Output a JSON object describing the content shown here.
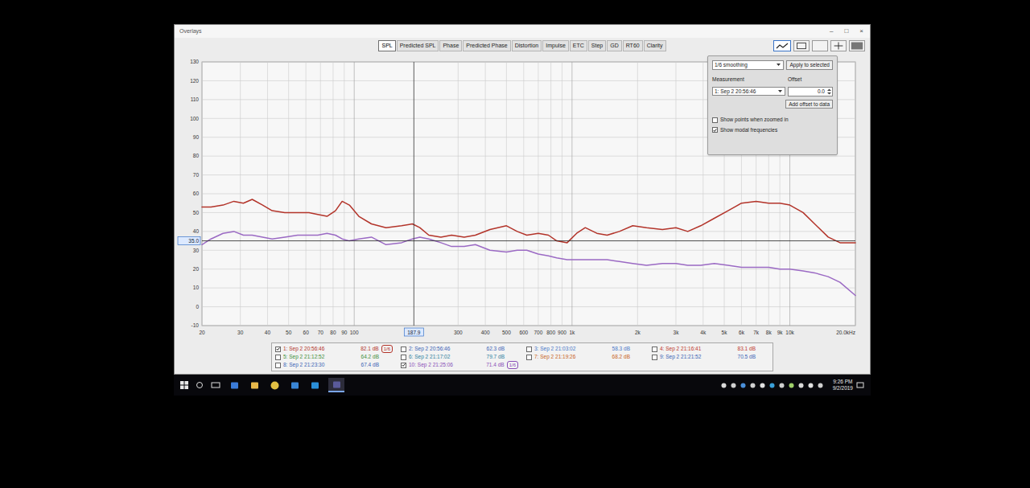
{
  "window": {
    "title": "Overlays",
    "controls": [
      "–",
      "□",
      "×"
    ]
  },
  "tabs": [
    {
      "label": "SPL",
      "selected": true
    },
    {
      "label": "Predicted SPL",
      "selected": false
    },
    {
      "label": "Phase",
      "selected": false
    },
    {
      "label": "Predicted Phase",
      "selected": false
    },
    {
      "label": "Distortion",
      "selected": false
    },
    {
      "label": "Impulse",
      "selected": false
    },
    {
      "label": "ETC",
      "selected": false
    },
    {
      "label": "Step",
      "selected": false
    },
    {
      "label": "GD",
      "selected": false
    },
    {
      "label": "RT60",
      "selected": false
    },
    {
      "label": "Clarity",
      "selected": false
    }
  ],
  "overlay_panel": {
    "smoothing": "1/6 smoothing",
    "apply_button": "Apply to selected",
    "measurement_label": "Measurement",
    "measurement": "1: Sep 2 20:56:46",
    "offset_label": "Offset",
    "offset": "0.0",
    "add_offset_button": "Add offset to data",
    "options": [
      {
        "label": "Show points when zoomed in",
        "checked": false
      },
      {
        "label": "Show modal frequencies",
        "checked": true
      }
    ]
  },
  "chart": {
    "y_ticks": [
      {
        "label": "130",
        "value": 130
      },
      {
        "label": "120",
        "value": 120
      },
      {
        "label": "110",
        "value": 110
      },
      {
        "label": "100",
        "value": 100
      },
      {
        "label": "90",
        "value": 90
      },
      {
        "label": "80",
        "value": 80
      },
      {
        "label": "70",
        "value": 70
      },
      {
        "label": "60",
        "value": 60
      },
      {
        "label": "50",
        "value": 50
      },
      {
        "label": "40",
        "value": 40
      },
      {
        "label": "30",
        "value": 30
      },
      {
        "label": "20",
        "value": 20
      },
      {
        "label": "10",
        "value": 10
      },
      {
        "label": "0",
        "value": 0
      },
      {
        "label": "-10",
        "value": -10
      }
    ],
    "x_ticks": [
      {
        "label": "20",
        "value": 20
      },
      {
        "label": "30",
        "value": 30
      },
      {
        "label": "40",
        "value": 40
      },
      {
        "label": "50",
        "value": 50
      },
      {
        "label": "60",
        "value": 60
      },
      {
        "label": "70",
        "value": 70
      },
      {
        "label": "80",
        "value": 80
      },
      {
        "label": "90",
        "value": 90
      },
      {
        "label": "100",
        "value": 100
      },
      {
        "label": "300",
        "value": 300
      },
      {
        "label": "400",
        "value": 400
      },
      {
        "label": "500",
        "value": 500
      },
      {
        "label": "600",
        "value": 600
      },
      {
        "label": "700",
        "value": 700
      },
      {
        "label": "800",
        "value": 800
      },
      {
        "label": "900",
        "value": 900
      },
      {
        "label": "1k",
        "value": 1000
      },
      {
        "label": "2k",
        "value": 2000
      },
      {
        "label": "3k",
        "value": 3000
      },
      {
        "label": "4k",
        "value": 4000
      },
      {
        "label": "5k",
        "value": 5000
      },
      {
        "label": "6k",
        "value": 6000
      },
      {
        "label": "7k",
        "value": 7000
      },
      {
        "label": "8k",
        "value": 8000
      },
      {
        "label": "9k",
        "value": 9000
      },
      {
        "label": "10k",
        "value": 10000
      },
      {
        "label": "20.0kHz",
        "value": 20000
      }
    ],
    "cursor": {
      "freq": 187.9,
      "freq_label": "187.9",
      "level": 35,
      "level_label": "35.0"
    },
    "series": [
      {
        "name": "1: Sep 2 20:56:46",
        "color": "#b3342a",
        "freqs": [
          20,
          22,
          25,
          28,
          31,
          34,
          38,
          42,
          48,
          55,
          62,
          68,
          75,
          82,
          88,
          95,
          105,
          120,
          140,
          165,
          185,
          200,
          220,
          250,
          280,
          320,
          360,
          420,
          500,
          560,
          620,
          700,
          780,
          850,
          950,
          1050,
          1150,
          1300,
          1450,
          1650,
          1900,
          2200,
          2600,
          3000,
          3400,
          3900,
          4500,
          5200,
          6000,
          7000,
          8000,
          9000,
          10000,
          11500,
          13000,
          15000,
          17000,
          20000
        ],
        "values": [
          53,
          53,
          54,
          56,
          55,
          57,
          54,
          51,
          50,
          50,
          50,
          49,
          48,
          51,
          56,
          54,
          48,
          44,
          42,
          43,
          44,
          42,
          38,
          37,
          38,
          37,
          38,
          41,
          43,
          40,
          38,
          39,
          38,
          35,
          34,
          39,
          42,
          39,
          38,
          40,
          43,
          42,
          41,
          42,
          40,
          43,
          47,
          51,
          55,
          56,
          55,
          55,
          54,
          50,
          44,
          37,
          34,
          34
        ]
      },
      {
        "name": "10: Sep 2 21:25:06",
        "color": "#9b6ac4",
        "freqs": [
          20,
          22,
          25,
          28,
          31,
          34,
          38,
          42,
          48,
          55,
          62,
          68,
          75,
          82,
          88,
          95,
          105,
          120,
          140,
          165,
          185,
          200,
          220,
          250,
          280,
          320,
          360,
          420,
          500,
          560,
          620,
          700,
          780,
          850,
          950,
          1050,
          1150,
          1300,
          1450,
          1650,
          1900,
          2200,
          2600,
          3000,
          3400,
          3900,
          4500,
          5200,
          6000,
          7000,
          8000,
          9000,
          10000,
          11500,
          13000,
          15000,
          17000,
          20000
        ],
        "values": [
          33,
          36,
          39,
          40,
          38,
          38,
          37,
          36,
          37,
          38,
          38,
          38,
          39,
          38,
          36,
          35,
          36,
          37,
          33,
          34,
          36,
          37,
          36,
          34,
          32,
          32,
          33,
          30,
          29,
          30,
          30,
          28,
          27,
          26,
          25,
          25,
          25,
          25,
          25,
          24,
          23,
          22,
          23,
          23,
          22,
          22,
          23,
          22,
          21,
          21,
          21,
          20,
          20,
          19,
          18,
          16,
          13,
          6
        ]
      }
    ]
  },
  "legend": {
    "columns": [
      [
        {
          "name": "1: Sep 2 20:56:46",
          "value": "82.1 dB",
          "checked": true,
          "smoothing": "1/6",
          "color": "#b3342a"
        },
        {
          "name": "5: Sep 2 21:12:52",
          "value": "64.2 dB",
          "checked": false,
          "color": "#3f8f3a"
        },
        {
          "name": "8: Sep 2 21:23:30",
          "value": "67.4 dB",
          "checked": false,
          "color": "#3b63b5"
        }
      ],
      [
        {
          "name": "2: Sep 2 20:56:46",
          "value": "62.3 dB",
          "checked": false,
          "color": "#3b63b5"
        },
        {
          "name": "6: Sep 2 21:17:02",
          "value": "79.7 dB",
          "checked": false,
          "color": "#2f7fa0"
        },
        {
          "name": "10: Sep 2 21:25:06",
          "value": "71.4 dB",
          "checked": true,
          "smoothing": "1/6",
          "color": "#8a4fb8"
        }
      ],
      [
        {
          "name": "3: Sep 2 21:03:02",
          "value": "58.3 dB",
          "checked": false,
          "color": "#4a78c8"
        },
        {
          "name": "7: Sep 2 21:19:26",
          "value": "68.2 dB",
          "checked": false,
          "color": "#c8641e"
        }
      ],
      [
        {
          "name": "4: Sep 2 21:16:41",
          "value": "83.1 dB",
          "checked": false,
          "color": "#c0392b"
        },
        {
          "name": "9: Sep 2 21:21:52",
          "value": "70.5 dB",
          "checked": false,
          "color": "#3b63b5"
        }
      ]
    ]
  },
  "taskbar": {
    "time": "9:26 PM",
    "date": "9/2/2019"
  }
}
